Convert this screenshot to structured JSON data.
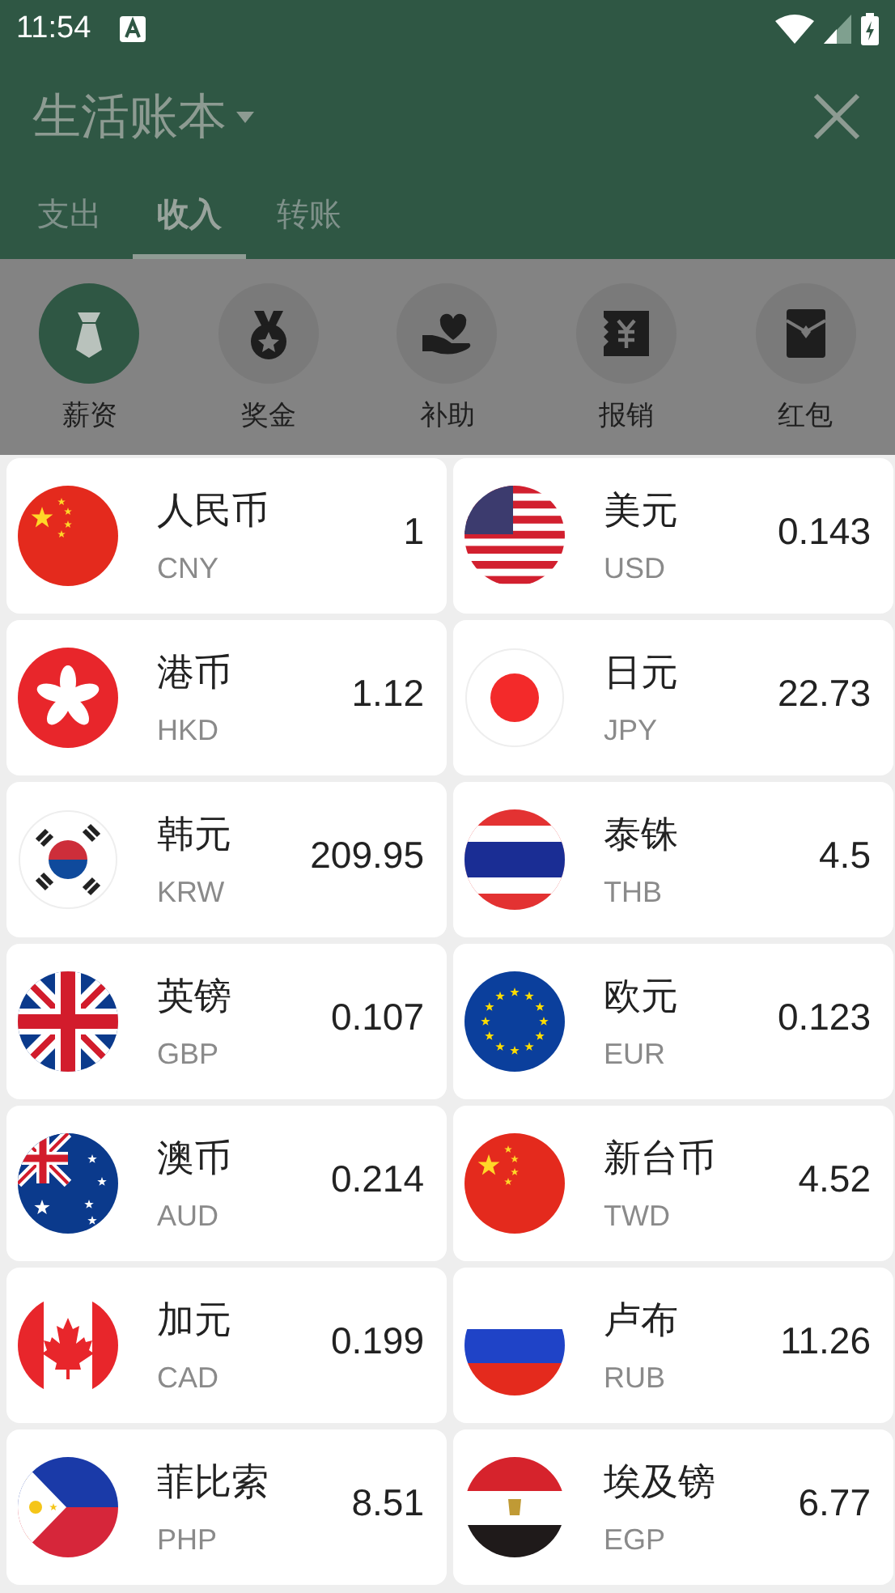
{
  "status_bar": {
    "time": "11:54"
  },
  "header": {
    "title": "生活账本"
  },
  "tabs": [
    {
      "label": "支出",
      "selected": false
    },
    {
      "label": "收入",
      "selected": true
    },
    {
      "label": "转账",
      "selected": false
    }
  ],
  "categories": [
    {
      "label": "薪资",
      "selected": true
    },
    {
      "label": "奖金",
      "selected": false
    },
    {
      "label": "补助",
      "selected": false
    },
    {
      "label": "报销",
      "selected": false
    },
    {
      "label": "红包",
      "selected": false
    }
  ],
  "currencies": [
    {
      "name": "人民币",
      "code": "CNY",
      "rate": "1"
    },
    {
      "name": "美元",
      "code": "USD",
      "rate": "0.143"
    },
    {
      "name": "港币",
      "code": "HKD",
      "rate": "1.12"
    },
    {
      "name": "日元",
      "code": "JPY",
      "rate": "22.73"
    },
    {
      "name": "韩元",
      "code": "KRW",
      "rate": "209.95"
    },
    {
      "name": "泰铢",
      "code": "THB",
      "rate": "4.5"
    },
    {
      "name": "英镑",
      "code": "GBP",
      "rate": "0.107"
    },
    {
      "name": "欧元",
      "code": "EUR",
      "rate": "0.123"
    },
    {
      "name": "澳币",
      "code": "AUD",
      "rate": "0.214"
    },
    {
      "name": "新台币",
      "code": "TWD",
      "rate": "4.52"
    },
    {
      "name": "加元",
      "code": "CAD",
      "rate": "0.199"
    },
    {
      "name": "卢布",
      "code": "RUB",
      "rate": "11.26"
    },
    {
      "name": "菲比索",
      "code": "PHP",
      "rate": "8.51"
    },
    {
      "name": "埃及镑",
      "code": "EGP",
      "rate": "6.77"
    }
  ]
}
